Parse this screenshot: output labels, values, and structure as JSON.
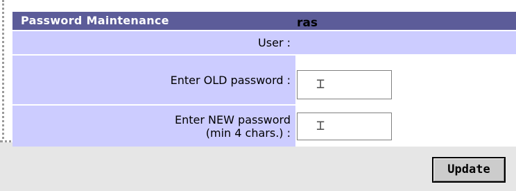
{
  "form": {
    "title": "Password Maintenance",
    "user_label": "User :",
    "user_value": "ras",
    "old_label": "Enter OLD password :",
    "new_label_line1": "Enter NEW password",
    "new_label_line2": "(min 4 chars.) :",
    "old_value": "",
    "new_value": ""
  },
  "actions": {
    "update_label": "Update"
  },
  "colors": {
    "title_bg": "#5c5c99",
    "row_bg": "#ccccff"
  }
}
